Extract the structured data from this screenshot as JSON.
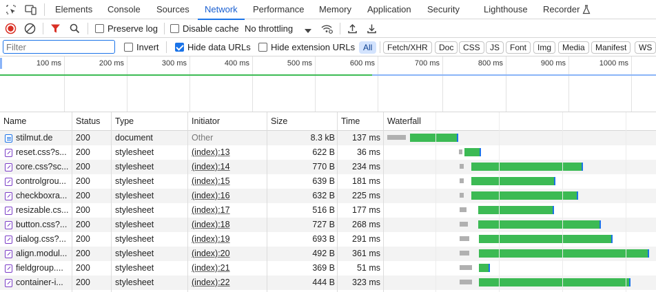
{
  "tabs": [
    "Elements",
    "Console",
    "Sources",
    "Network",
    "Performance",
    "Memory",
    "Application",
    "Security",
    "Lighthouse",
    "Recorder"
  ],
  "active_tab": "Network",
  "toolbar": {
    "preserve_log": "Preserve log",
    "preserve_log_checked": false,
    "disable_cache": "Disable cache",
    "disable_cache_checked": false,
    "throttling": "No throttling"
  },
  "filterbar": {
    "filter_placeholder": "Filter",
    "invert": "Invert",
    "hide_data_urls": "Hide data URLs",
    "hide_data_urls_checked": true,
    "hide_extension_urls": "Hide extension URLs",
    "types": [
      "All",
      "Fetch/XHR",
      "Doc",
      "CSS",
      "JS",
      "Font",
      "Img",
      "Media",
      "Manifest",
      "WS"
    ],
    "active_type": "All"
  },
  "overview": {
    "ticks": [
      "100 ms",
      "200 ms",
      "300 ms",
      "400 ms",
      "500 ms",
      "600 ms",
      "700 ms",
      "800 ms",
      "900 ms",
      "1000 ms"
    ]
  },
  "columns": [
    "Name",
    "Status",
    "Type",
    "Initiator",
    "Size",
    "Time",
    "Waterfall"
  ],
  "rows": [
    {
      "name": "stilmut.de",
      "status": "200",
      "type": "document",
      "initiator": "Other",
      "size": "8.3 kB",
      "time": "137 ms",
      "kind": "doc"
    },
    {
      "name": "reset.css?s...",
      "status": "200",
      "type": "stylesheet",
      "initiator": "(index):13",
      "size": "622 B",
      "time": "36 ms",
      "kind": "css"
    },
    {
      "name": "core.css?sc...",
      "status": "200",
      "type": "stylesheet",
      "initiator": "(index):14",
      "size": "770 B",
      "time": "234 ms",
      "kind": "css"
    },
    {
      "name": "controlgrou...",
      "status": "200",
      "type": "stylesheet",
      "initiator": "(index):15",
      "size": "639 B",
      "time": "181 ms",
      "kind": "css"
    },
    {
      "name": "checkboxra...",
      "status": "200",
      "type": "stylesheet",
      "initiator": "(index):16",
      "size": "632 B",
      "time": "225 ms",
      "kind": "css"
    },
    {
      "name": "resizable.cs...",
      "status": "200",
      "type": "stylesheet",
      "initiator": "(index):17",
      "size": "516 B",
      "time": "177 ms",
      "kind": "css"
    },
    {
      "name": "button.css?...",
      "status": "200",
      "type": "stylesheet",
      "initiator": "(index):18",
      "size": "727 B",
      "time": "268 ms",
      "kind": "css"
    },
    {
      "name": "dialog.css?...",
      "status": "200",
      "type": "stylesheet",
      "initiator": "(index):19",
      "size": "693 B",
      "time": "291 ms",
      "kind": "css"
    },
    {
      "name": "align.modul...",
      "status": "200",
      "type": "stylesheet",
      "initiator": "(index):20",
      "size": "492 B",
      "time": "361 ms",
      "kind": "css"
    },
    {
      "name": "fieldgroup....",
      "status": "200",
      "type": "stylesheet",
      "initiator": "(index):21",
      "size": "369 B",
      "time": "51 ms",
      "kind": "css"
    },
    {
      "name": "container-i...",
      "status": "200",
      "type": "stylesheet",
      "initiator": "(index):22",
      "size": "444 B",
      "time": "323 ms",
      "kind": "css"
    }
  ],
  "colors": {
    "accent": "#1a73e8",
    "receive": "#3cba54",
    "waiting": "#b0b0b0",
    "record": "#d93025",
    "filter": "#d93025"
  }
}
